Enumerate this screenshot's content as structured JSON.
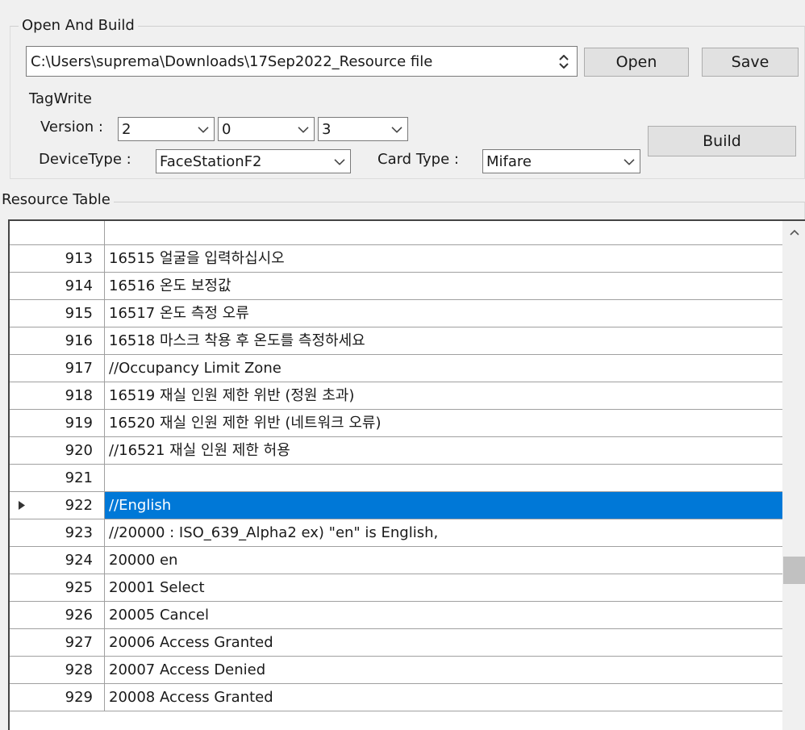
{
  "open_build": {
    "title": "Open And Build",
    "path_value": "C:\\Users\\suprema\\Downloads\\17Sep2022_Resource file",
    "open_label": "Open",
    "save_label": "Save",
    "build_label": "Build",
    "tagwrite_label": "TagWrite",
    "version_label": "Version :",
    "version_major": "2",
    "version_minor": "0",
    "version_patch": "3",
    "device_type_label": "DeviceType :",
    "device_type_value": "FaceStationF2",
    "card_type_label": "Card Type :",
    "card_type_value": "Mifare"
  },
  "resource_table": {
    "title": "Resource Table",
    "selected_row": 922,
    "rows": [
      {
        "num": "913",
        "text": "16515 얼굴을 입력하십시오"
      },
      {
        "num": "914",
        "text": "16516 온도 보정값"
      },
      {
        "num": "915",
        "text": "16517 온도 측정 오류"
      },
      {
        "num": "916",
        "text": "16518 마스크 착용 후 온도를 측정하세요"
      },
      {
        "num": "917",
        "text": "//Occupancy Limit Zone"
      },
      {
        "num": "918",
        "text": "16519 재실 인원 제한 위반 (정원 초과)"
      },
      {
        "num": "919",
        "text": "16520 재실 인원 제한 위반 (네트워크 오류)"
      },
      {
        "num": "920",
        "text": "//16521 재실 인원 제한 허용"
      },
      {
        "num": "921",
        "text": ""
      },
      {
        "num": "922",
        "text": "//English"
      },
      {
        "num": "923",
        "text": "//20000 : ISO_639_Alpha2 ex) \"en\" is English,"
      },
      {
        "num": "924",
        "text": "20000 en"
      },
      {
        "num": "925",
        "text": "20001 Select"
      },
      {
        "num": "926",
        "text": "20005 Cancel"
      },
      {
        "num": "927",
        "text": "20006 Access Granted"
      },
      {
        "num": "928",
        "text": "20007 Access Denied"
      },
      {
        "num": "929",
        "text": "20008 Access Granted"
      }
    ]
  },
  "colors": {
    "selection": "#0078d7",
    "window_bg": "#f0f0f0"
  }
}
